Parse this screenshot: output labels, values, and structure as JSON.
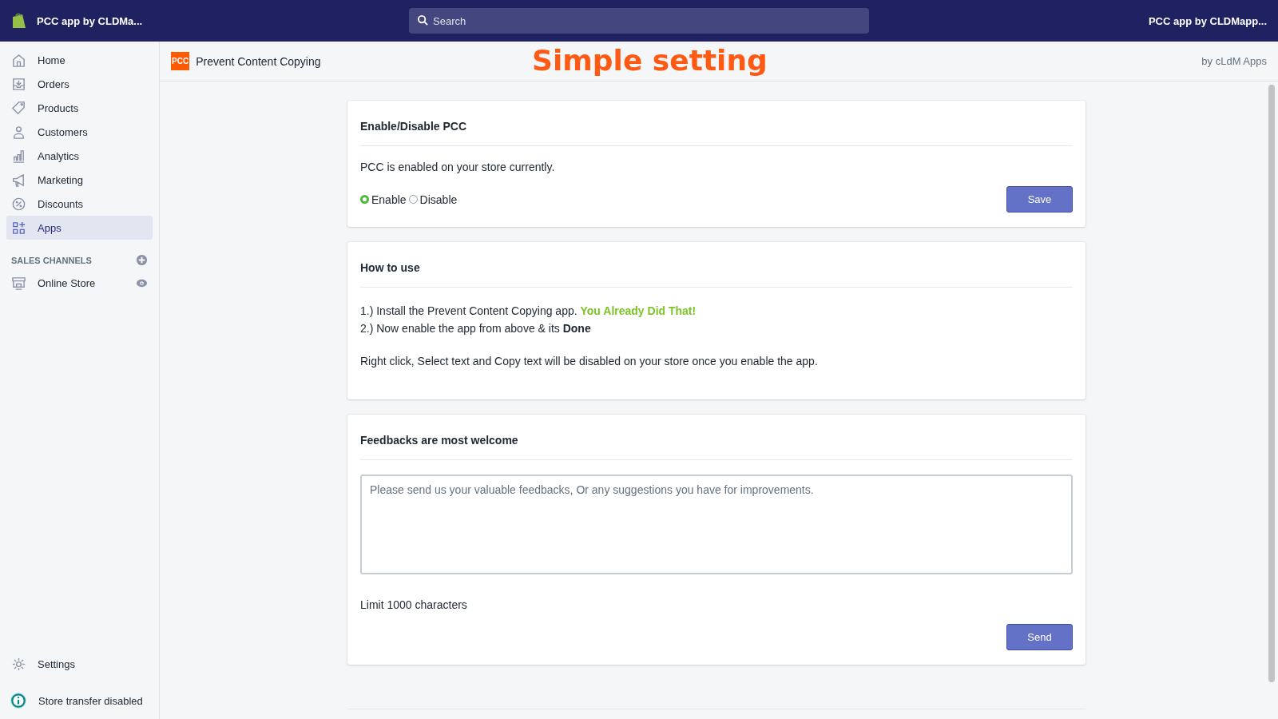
{
  "topbar": {
    "store_name": "PCC app by CLDMa...",
    "search": {
      "placeholder": "Search"
    },
    "account": "PCC app by CLDMapp..."
  },
  "sidebar": {
    "items": [
      {
        "label": "Home",
        "kind": "home",
        "selected": false
      },
      {
        "label": "Orders",
        "kind": "orders",
        "selected": false
      },
      {
        "label": "Products",
        "kind": "tag",
        "selected": false
      },
      {
        "label": "Customers",
        "kind": "person",
        "selected": false
      },
      {
        "label": "Analytics",
        "kind": "chart",
        "selected": false
      },
      {
        "label": "Marketing",
        "kind": "megaphone",
        "selected": false
      },
      {
        "label": "Discounts",
        "kind": "discount",
        "selected": false
      },
      {
        "label": "Apps",
        "kind": "apps",
        "selected": true
      }
    ],
    "channels_heading": "SALES CHANNELS",
    "channels": [
      {
        "label": "Online Store",
        "selected": false
      }
    ],
    "settings": "Settings",
    "notice": "Store transfer disabled"
  },
  "app_header": {
    "logo": "PCC",
    "title": "Prevent Content Copying",
    "banner": "Simple setting",
    "by": "by cLdM Apps"
  },
  "cards": [
    {
      "kind": "toggle",
      "title": "Enable/Disable PCC",
      "status": "PCC is enabled on your store currently.",
      "options": [
        {
          "label": "Enable",
          "selected": true
        },
        {
          "label": "Disable",
          "selected": false
        }
      ],
      "button": "Save"
    },
    {
      "kind": "howto",
      "title": "How to use",
      "steps": [
        {
          "text": "1.) Install the Prevent Content Copying app.",
          "highlight": "You Already Did That!"
        },
        {
          "text": "2.) Now enable the app from above & its **Done**"
        }
      ],
      "note": "Right click, Select text and Copy text will be disabled on your store once you enable the app."
    },
    {
      "kind": "feedback",
      "title": "Feedbacks are most welcome",
      "placeholder": "Please send us your valuable feedbacks, Or any suggestions you have for improvements.",
      "limit": "Limit 1000 characters",
      "button": "Send"
    }
  ]
}
